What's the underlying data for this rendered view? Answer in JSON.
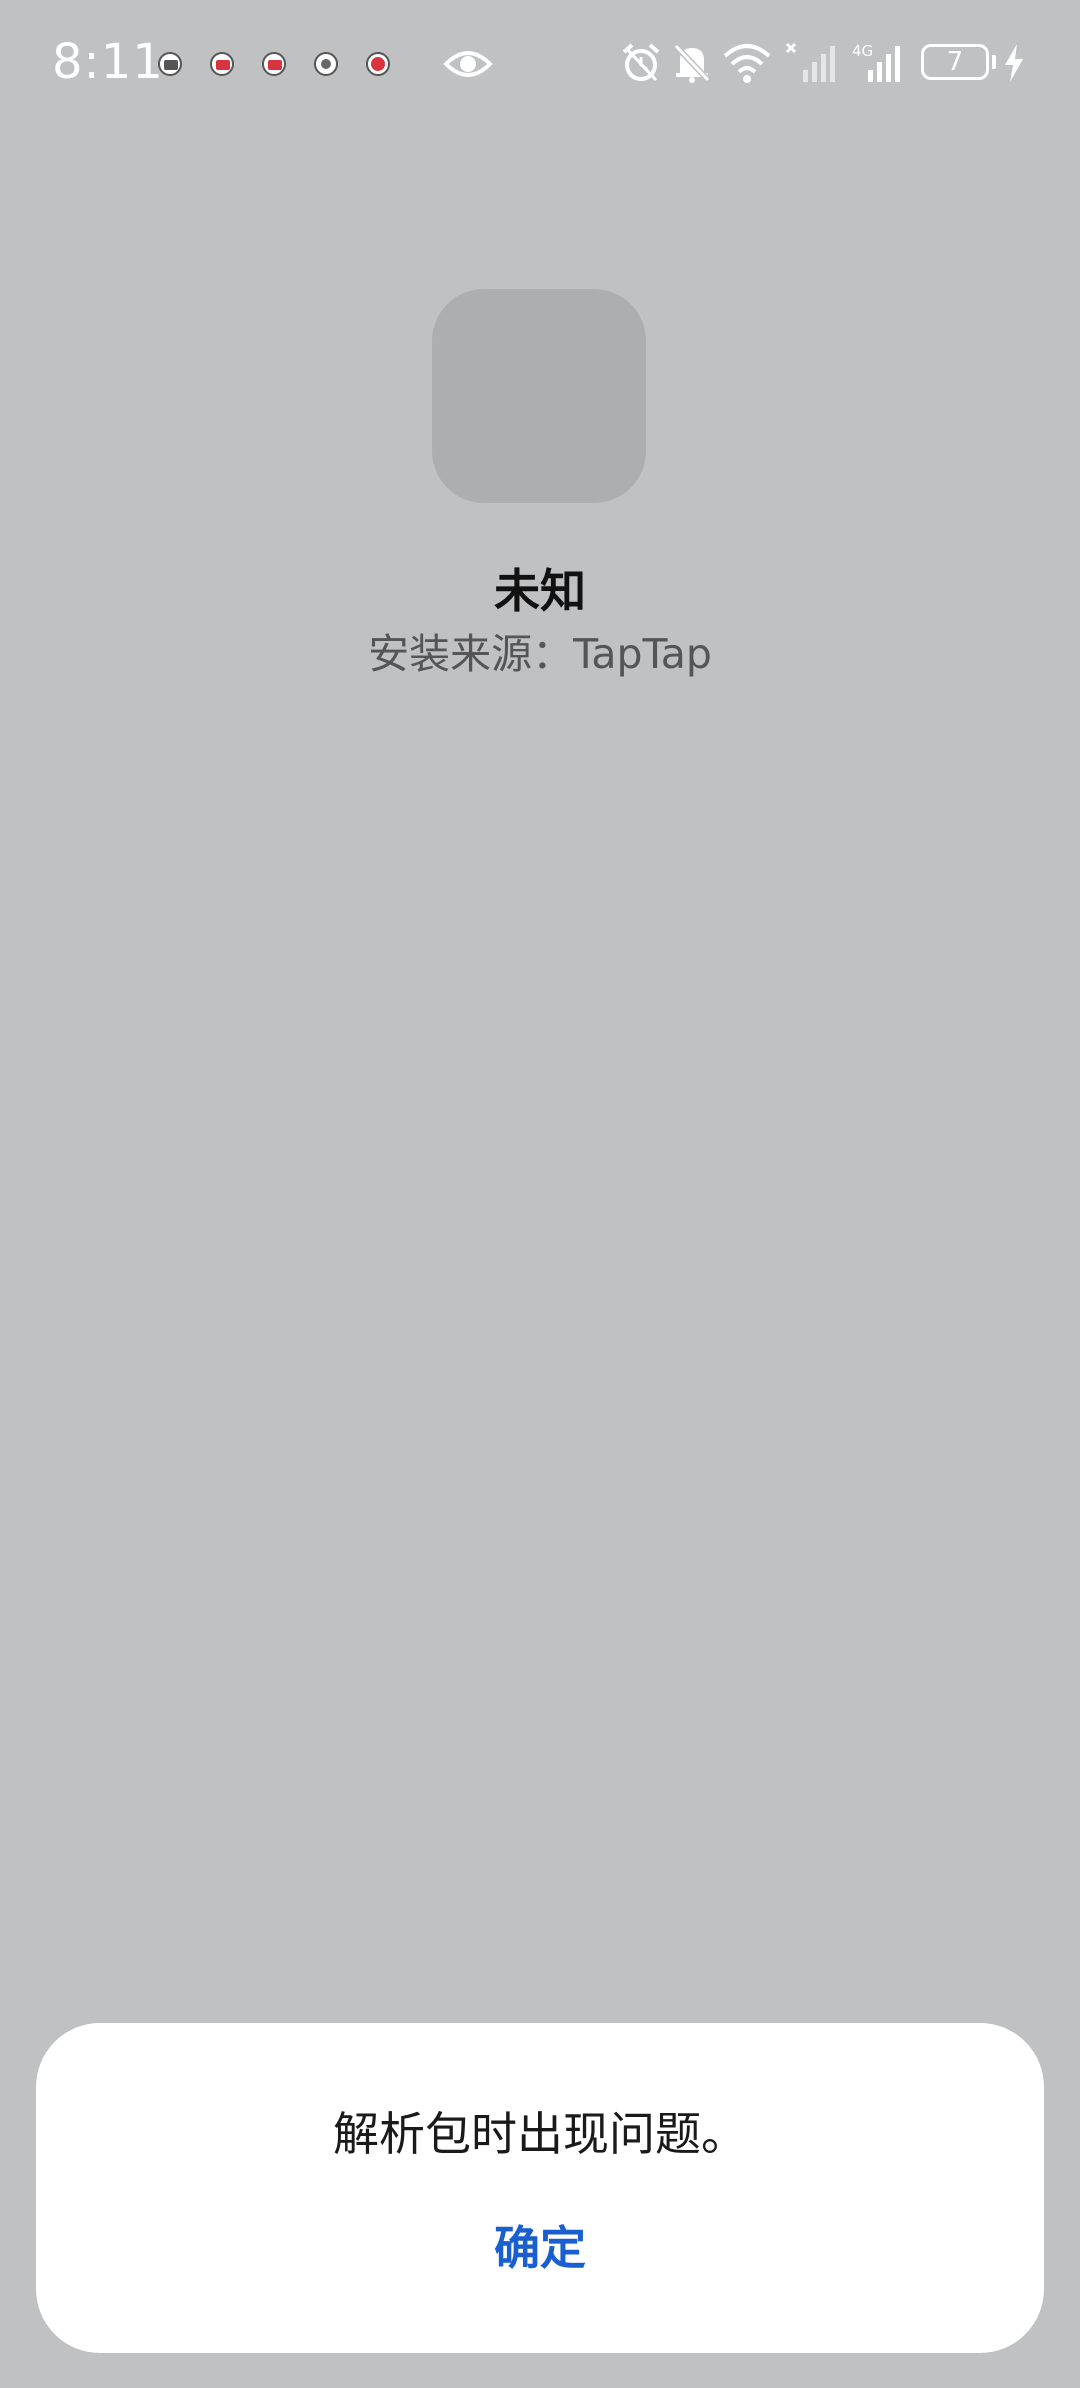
{
  "status_bar": {
    "time": "8:11",
    "battery_level": "7",
    "network_label": "4G",
    "notification_icons": [
      "keyboard-app-icon",
      "video-app-icon",
      "video-app-icon-2",
      "target-app-icon",
      "red-app-icon"
    ],
    "status_icons": [
      "eye-icon",
      "alarm-icon",
      "bell-muted-icon",
      "wifi-icon",
      "signal-no-sim-icon",
      "signal-4g-icon",
      "battery-icon",
      "charging-bolt-icon"
    ]
  },
  "app": {
    "name": "未知",
    "install_source": "安装来源：TapTap"
  },
  "dialog": {
    "message": "解析包时出现问题。",
    "confirm_label": "确定"
  },
  "colors": {
    "background": "#c0c1c3",
    "icon_placeholder": "#adaeb0",
    "accent": "#1a5fd0",
    "dialog_bg": "#ffffff"
  }
}
